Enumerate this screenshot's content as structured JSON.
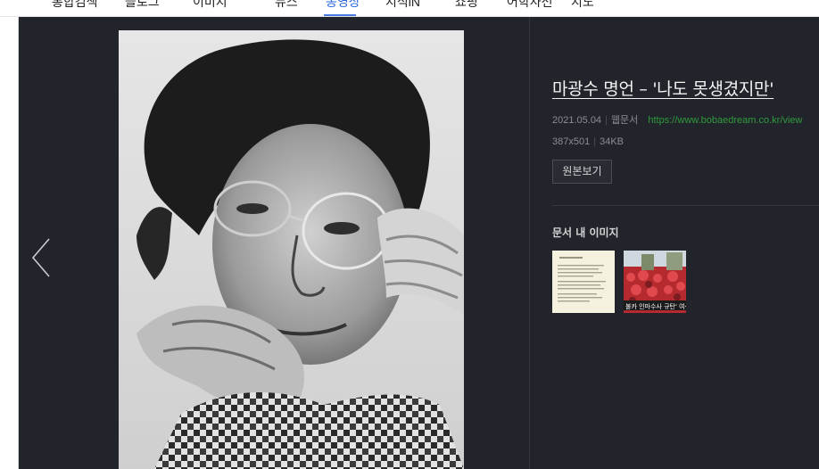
{
  "nav": {
    "tabs": [
      {
        "label": "통합검색"
      },
      {
        "label": "블로그"
      },
      {
        "label": "이미지"
      },
      {
        "label": "뉴스"
      },
      {
        "label": "동영상"
      },
      {
        "label": "지식iN"
      },
      {
        "label": "쇼핑"
      },
      {
        "label": "어학사전"
      },
      {
        "label": "지도"
      }
    ]
  },
  "viewer": {
    "title": "마광수 명언 – '나도 못생겼지만'",
    "date": "2021.05.04",
    "source_type": "웹문서",
    "url": "https://www.bobaedream.co.kr/view",
    "dimensions": "387x501",
    "filesize": "34KB",
    "original_button": "원본보기",
    "section_title": "문서 내 이미지",
    "thumb2_caption": "불카 인마수사 규탄' 여성 도심",
    "prev_icon": "chevron-left-icon"
  },
  "colors": {
    "viewer_bg": "#22242b",
    "link": "#2f9a3c",
    "nav_active": "#2b67e0"
  }
}
